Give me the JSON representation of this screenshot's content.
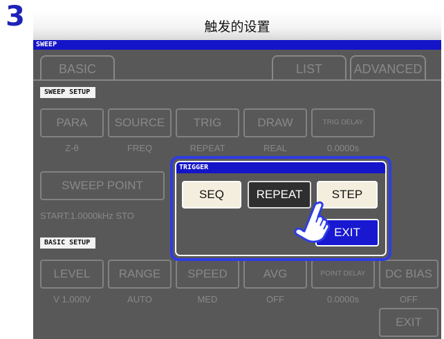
{
  "step_number": "3",
  "title": "触发的设置",
  "screen": {
    "header": "SWEEP",
    "tabs": {
      "basic": "BASIC",
      "list": "LIST",
      "advanced": "ADVANCED"
    },
    "sweep_setup": {
      "label": "SWEEP SETUP",
      "buttons": [
        "PARA",
        "SOURCE",
        "TRIG",
        "DRAW",
        "TRIG DELAY"
      ],
      "values": [
        "Z-θ",
        "FREQ",
        "REPEAT",
        "REAL",
        "0.0000s"
      ]
    },
    "sweep_point": {
      "label": "SWEEP POINT",
      "value": "START:1.0000kHz STO"
    },
    "basic_setup": {
      "label": "BASIC SETUP",
      "buttons": [
        "LEVEL",
        "RANGE",
        "SPEED",
        "AVG",
        "POINT DELAY",
        "DC BIAS"
      ],
      "values": [
        "V 1.000V",
        "AUTO",
        "MED",
        "OFF",
        "0.0000s",
        "OFF"
      ]
    },
    "exit_label": "EXIT"
  },
  "dialog": {
    "title": "TRIGGER",
    "options": [
      "SEQ",
      "REPEAT",
      "STEP"
    ],
    "selected": "REPEAT",
    "exit_label": "EXIT"
  },
  "colors": {
    "accent_blue": "#2d3ce6",
    "header_blue": "#1414c8",
    "screen_gray": "#585858",
    "step_blue": "#1e22b8"
  },
  "icons": {
    "pointer": "hand-pointer-icon"
  }
}
